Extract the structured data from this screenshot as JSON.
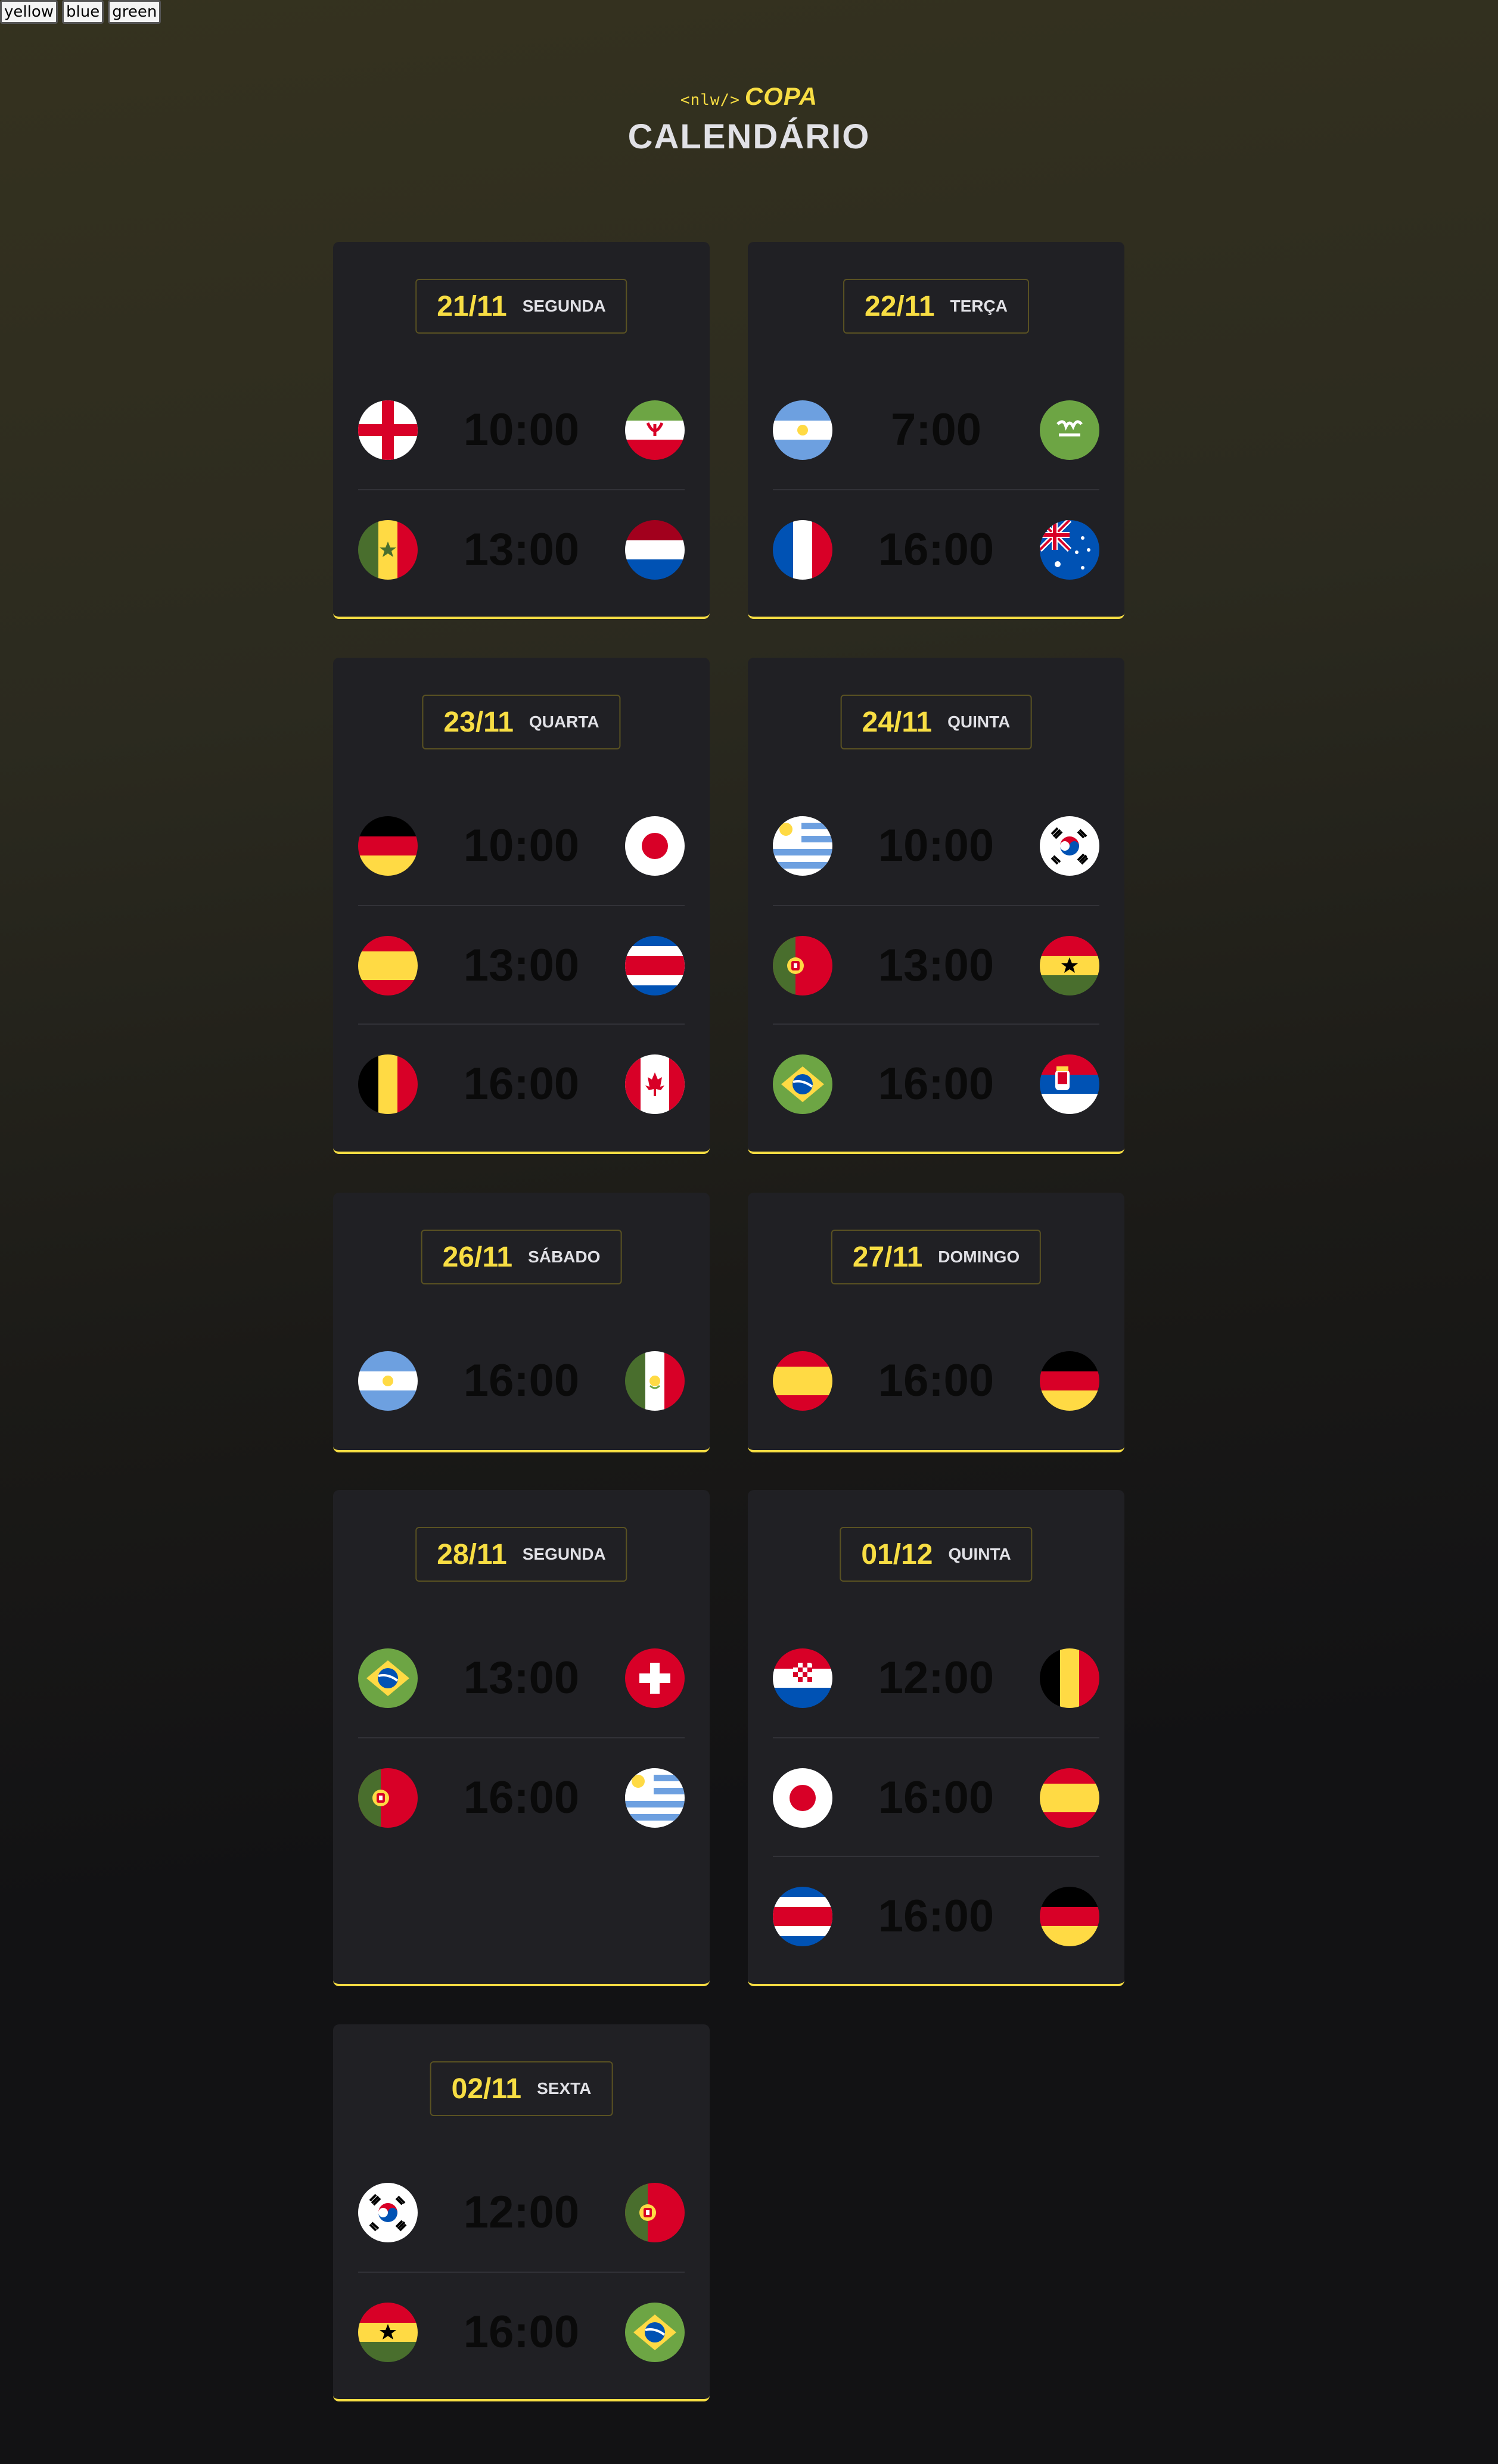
{
  "theme_buttons": [
    "yellow",
    "blue",
    "green"
  ],
  "header": {
    "logo_code": "<nlw/>",
    "logo_word": "COPA",
    "title": "CALENDÁRIO"
  },
  "days": [
    {
      "date": "21/11",
      "weekday": "SEGUNDA",
      "matches": [
        {
          "home": "england-flag-icon",
          "time": "10:00",
          "away": "iran-flag-icon"
        },
        {
          "home": "senegal-flag-icon",
          "time": "13:00",
          "away": "netherlands-flag-icon"
        }
      ]
    },
    {
      "date": "22/11",
      "weekday": "TERÇA",
      "matches": [
        {
          "home": "argentina-flag-icon",
          "time": "7:00",
          "away": "saudi-arabia-flag-icon"
        },
        {
          "home": "france-flag-icon",
          "time": "16:00",
          "away": "australia-flag-icon"
        }
      ]
    },
    {
      "date": "23/11",
      "weekday": "QUARTA",
      "matches": [
        {
          "home": "germany-flag-icon",
          "time": "10:00",
          "away": "japan-flag-icon"
        },
        {
          "home": "spain-flag-icon",
          "time": "13:00",
          "away": "costa-rica-flag-icon"
        },
        {
          "home": "belgium-flag-icon",
          "time": "16:00",
          "away": "canada-flag-icon"
        }
      ]
    },
    {
      "date": "24/11",
      "weekday": "QUINTA",
      "matches": [
        {
          "home": "uruguay-flag-icon",
          "time": "10:00",
          "away": "south-korea-flag-icon"
        },
        {
          "home": "portugal-flag-icon",
          "time": "13:00",
          "away": "ghana-flag-icon"
        },
        {
          "home": "brazil-flag-icon",
          "time": "16:00",
          "away": "serbia-flag-icon"
        }
      ]
    },
    {
      "date": "26/11",
      "weekday": "SÁBADO",
      "matches": [
        {
          "home": "argentina-flag-icon",
          "time": "16:00",
          "away": "mexico-flag-icon"
        }
      ]
    },
    {
      "date": "27/11",
      "weekday": "DOMINGO",
      "matches": [
        {
          "home": "spain-flag-icon",
          "time": "16:00",
          "away": "germany-flag-icon"
        }
      ]
    },
    {
      "date": "28/11",
      "weekday": "SEGUNDA",
      "matches": [
        {
          "home": "brazil-flag-icon",
          "time": "13:00",
          "away": "switzerland-flag-icon"
        },
        {
          "home": "portugal-flag-icon",
          "time": "16:00",
          "away": "uruguay-flag-icon"
        }
      ]
    },
    {
      "date": "01/12",
      "weekday": "QUINTA",
      "matches": [
        {
          "home": "croatia-flag-icon",
          "time": "12:00",
          "away": "belgium-flag-icon"
        },
        {
          "home": "japan-flag-icon",
          "time": "16:00",
          "away": "spain-flag-icon"
        },
        {
          "home": "costa-rica-flag-icon",
          "time": "16:00",
          "away": "germany-flag-icon"
        }
      ]
    },
    {
      "date": "02/11",
      "weekday": "SEXTA",
      "matches": [
        {
          "home": "south-korea-flag-icon",
          "time": "12:00",
          "away": "portugal-flag-icon"
        },
        {
          "home": "ghana-flag-icon",
          "time": "16:00",
          "away": "brazil-flag-icon"
        }
      ]
    }
  ],
  "colors": {
    "accent": "#f7dd43",
    "card": "#202024",
    "time": "#0a0a0a"
  }
}
